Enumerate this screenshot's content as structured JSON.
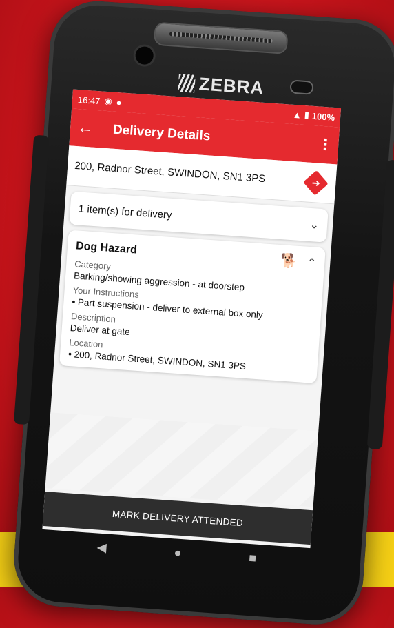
{
  "device": {
    "brand": "ZEBRA"
  },
  "status": {
    "time": "16:47",
    "battery": "100%"
  },
  "appbar": {
    "title": "Delivery Details",
    "menu": "⋮",
    "back": "←"
  },
  "address": {
    "text": "200, Radnor Street, SWINDON, SN1 3PS"
  },
  "items": {
    "label": "1 item(s) for delivery"
  },
  "hazard": {
    "title": "Dog Hazard",
    "category_label": "Category",
    "category_value": "Barking/showing aggression - at doorstep",
    "instructions_label": "Your Instructions",
    "instructions_value": "Part suspension - deliver to external box only",
    "description_label": "Description",
    "description_value": "Deliver at gate",
    "location_label": "Location",
    "location_value": "200, Radnor Street, SWINDON, SN1 3PS"
  },
  "actions": {
    "attend_label": "MARK DELIVERY ATTENDED"
  },
  "colors": {
    "accent": "#e52a2f",
    "button": "#2e2e2e",
    "background": "#c8141b",
    "stripe": "#f5cf15"
  },
  "icons": {
    "back": "arrow-left-icon",
    "menu": "more-vert-icon",
    "navigate": "directions-icon",
    "expand": "chevron-down-icon",
    "collapse": "chevron-up-icon",
    "dog": "dog-icon"
  }
}
